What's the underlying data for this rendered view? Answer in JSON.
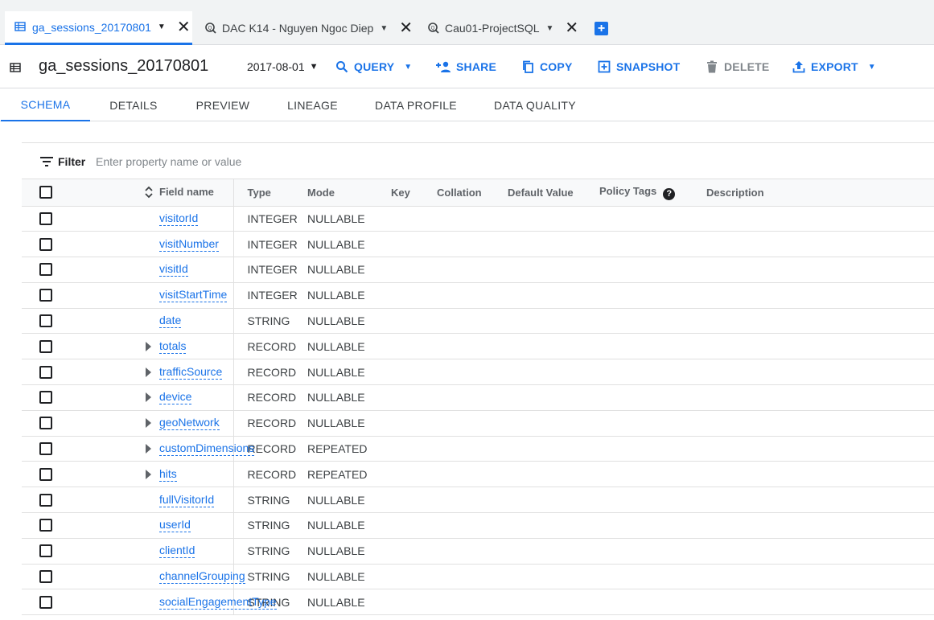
{
  "tabs": [
    {
      "label": "ga_sessions_20170801",
      "icon": "table-icon",
      "active": true
    },
    {
      "label": "DAC K14 - Nguyen Ngoc Diep",
      "icon": "query-icon",
      "active": false
    },
    {
      "label": "Cau01-ProjectSQL",
      "icon": "query-icon",
      "active": false
    }
  ],
  "header": {
    "title": "ga_sessions_20170801",
    "date": "2017-08-01",
    "actions": {
      "query": "QUERY",
      "share": "SHARE",
      "copy": "COPY",
      "snapshot": "SNAPSHOT",
      "delete": "DELETE",
      "export": "EXPORT"
    }
  },
  "subtabs": [
    "SCHEMA",
    "DETAILS",
    "PREVIEW",
    "LINEAGE",
    "DATA PROFILE",
    "DATA QUALITY"
  ],
  "filter": {
    "label": "Filter",
    "placeholder": "Enter property name or value"
  },
  "columns": {
    "field_name": "Field name",
    "type": "Type",
    "mode": "Mode",
    "key": "Key",
    "collation": "Collation",
    "default_value": "Default Value",
    "policy_tags": "Policy Tags",
    "description": "Description"
  },
  "rows": [
    {
      "name": "visitorId",
      "type": "INTEGER",
      "mode": "NULLABLE",
      "expandable": false
    },
    {
      "name": "visitNumber",
      "type": "INTEGER",
      "mode": "NULLABLE",
      "expandable": false
    },
    {
      "name": "visitId",
      "type": "INTEGER",
      "mode": "NULLABLE",
      "expandable": false
    },
    {
      "name": "visitStartTime",
      "type": "INTEGER",
      "mode": "NULLABLE",
      "expandable": false
    },
    {
      "name": "date",
      "type": "STRING",
      "mode": "NULLABLE",
      "expandable": false
    },
    {
      "name": "totals",
      "type": "RECORD",
      "mode": "NULLABLE",
      "expandable": true
    },
    {
      "name": "trafficSource",
      "type": "RECORD",
      "mode": "NULLABLE",
      "expandable": true
    },
    {
      "name": "device",
      "type": "RECORD",
      "mode": "NULLABLE",
      "expandable": true
    },
    {
      "name": "geoNetwork",
      "type": "RECORD",
      "mode": "NULLABLE",
      "expandable": true
    },
    {
      "name": "customDimensions",
      "type": "RECORD",
      "mode": "REPEATED",
      "expandable": true
    },
    {
      "name": "hits",
      "type": "RECORD",
      "mode": "REPEATED",
      "expandable": true
    },
    {
      "name": "fullVisitorId",
      "type": "STRING",
      "mode": "NULLABLE",
      "expandable": false
    },
    {
      "name": "userId",
      "type": "STRING",
      "mode": "NULLABLE",
      "expandable": false
    },
    {
      "name": "clientId",
      "type": "STRING",
      "mode": "NULLABLE",
      "expandable": false
    },
    {
      "name": "channelGrouping",
      "type": "STRING",
      "mode": "NULLABLE",
      "expandable": false
    },
    {
      "name": "socialEngagementType",
      "type": "STRING",
      "mode": "NULLABLE",
      "expandable": false
    }
  ],
  "colors": {
    "accent": "#1a73e8",
    "text": "#202124",
    "muted": "#5f6368",
    "border": "#e0e0e0",
    "tabstrip_bg": "#f1f3f4"
  }
}
